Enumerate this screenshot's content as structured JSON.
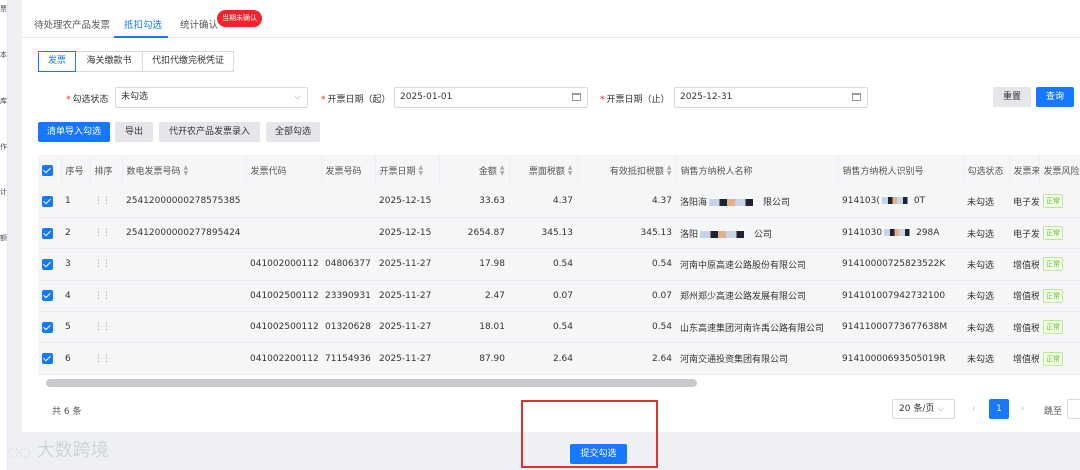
{
  "sidebar_fragments": [
    "票",
    "本",
    "库",
    "作",
    "计",
    "额"
  ],
  "top_tabs": [
    {
      "label": "待处理农产品发票"
    },
    {
      "label": "抵扣勾选"
    },
    {
      "label": "统计确认"
    }
  ],
  "badge": "当期未确认",
  "sub_tabs": [
    "发票",
    "海关缴款书",
    "代扣代缴完税凭证"
  ],
  "filters": {
    "status_label": "勾选状态",
    "status_value": "未勾选",
    "start_label": "开票日期（起）",
    "start_value": "2025-01-01",
    "end_label": "开票日期（止）",
    "end_value": "2025-12-31",
    "reset": "重置",
    "search": "查询"
  },
  "actions": [
    "清单导入勾选",
    "导出",
    "代开农产品发票录入",
    "全部勾选"
  ],
  "columns": [
    "序号",
    "排序",
    "数电发票号码",
    "发票代码",
    "发票号码",
    "开票日期",
    "金额",
    "票面税额",
    "有效抵扣税额",
    "销售方纳税人名称",
    "销售方纳税人识别号",
    "勾选状态",
    "发票来",
    "发票风险"
  ],
  "rows": [
    {
      "no": "1",
      "einv": "25412000000278575385",
      "code": "",
      "num": "",
      "date": "2025-12-15",
      "amount": "33.63",
      "tax": "4.37",
      "eff": "4.37",
      "seller_a": "洛阳海",
      "seller_b": "限公司",
      "sid_a": "914103(",
      "sid_b": "0T",
      "status": "未勾选",
      "src": "电子发",
      "risk": "正常"
    },
    {
      "no": "2",
      "einv": "25412000000277895424",
      "code": "",
      "num": "",
      "date": "2025-12-15",
      "amount": "2654.87",
      "tax": "345.13",
      "eff": "345.13",
      "seller_a": "洛阳",
      "seller_b": "公司",
      "sid_a": "9141030",
      "sid_b": "298A",
      "status": "未勾选",
      "src": "电子发",
      "risk": "正常"
    },
    {
      "no": "3",
      "einv": "",
      "code": "041002000112",
      "num": "04806377",
      "date": "2025-11-27",
      "amount": "17.98",
      "tax": "0.54",
      "eff": "0.54",
      "seller_a": "河南中原高速公路股份有限公司",
      "seller_b": "",
      "sid_a": "91410000725823522K",
      "sid_b": "",
      "status": "未勾选",
      "src": "增值税",
      "risk": "正常"
    },
    {
      "no": "4",
      "einv": "",
      "code": "041002500112",
      "num": "23390931",
      "date": "2025-11-27",
      "amount": "2.47",
      "tax": "0.07",
      "eff": "0.07",
      "seller_a": "郑州郑少高速公路发展有限公司",
      "seller_b": "",
      "sid_a": "914101007942732100",
      "sid_b": "",
      "status": "未勾选",
      "src": "增值税",
      "risk": "正常"
    },
    {
      "no": "5",
      "einv": "",
      "code": "041002500112",
      "num": "01320628",
      "date": "2025-11-27",
      "amount": "18.01",
      "tax": "0.54",
      "eff": "0.54",
      "seller_a": "山东高速集团河南许禹公路有限公司",
      "seller_b": "",
      "sid_a": "91411000773677638M",
      "sid_b": "",
      "status": "未勾选",
      "src": "增值税",
      "risk": "正常"
    },
    {
      "no": "6",
      "einv": "",
      "code": "041002200112",
      "num": "71154936",
      "date": "2025-11-27",
      "amount": "87.90",
      "tax": "2.64",
      "eff": "2.64",
      "seller_a": "河南交通投资集团有限公司",
      "seller_b": "",
      "sid_a": "91410000693505019R",
      "sid_b": "",
      "status": "未勾选",
      "src": "增值税",
      "risk": "正常"
    }
  ],
  "footer": {
    "total": "共 6 条",
    "page_size": "20 条/页",
    "page": "1",
    "jump": "跳至",
    "submit": "提交勾选"
  },
  "watermark": "大数跨境",
  "colors": {
    "primary": "#1677ff",
    "highlight": "#e03131",
    "success": "#52c41a"
  }
}
